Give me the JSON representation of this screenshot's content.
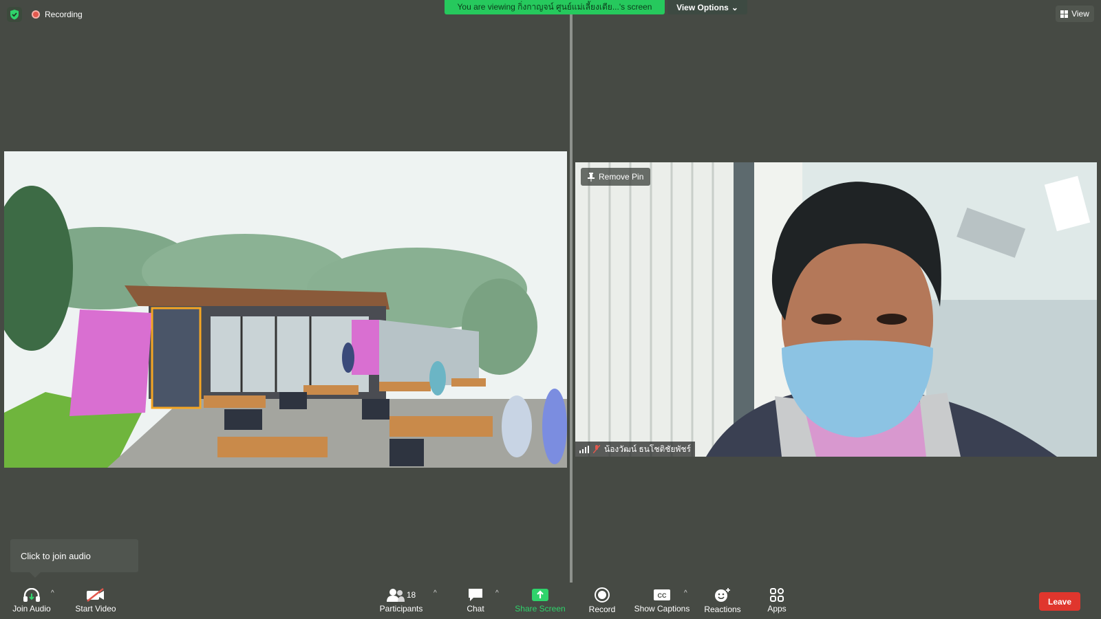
{
  "header": {
    "recording_label": "Recording",
    "viewing_banner": "You are viewing กิ่งกาญจน์ ศูนย์แม่เลี้ยงเตีย...'s screen",
    "view_options_label": "View Options",
    "view_label": "View"
  },
  "video": {
    "remove_pin_label": "Remove Pin",
    "participant_name": "น้องวัฒน์ ธนโชติชัยพัชร์"
  },
  "tooltip": {
    "join_audio_tip": "Click to join audio"
  },
  "toolbar": {
    "join_audio": "Join Audio",
    "start_video": "Start Video",
    "participants": "Participants",
    "participants_count": "18",
    "chat": "Chat",
    "share_screen": "Share Screen",
    "record": "Record",
    "show_captions": "Show Captions",
    "reactions": "Reactions",
    "apps": "Apps",
    "leave": "Leave"
  },
  "colors": {
    "background": "#464a44",
    "banner_green": "#26c95d",
    "leave_red": "#e0362d",
    "share_green": "#2fd36b"
  }
}
